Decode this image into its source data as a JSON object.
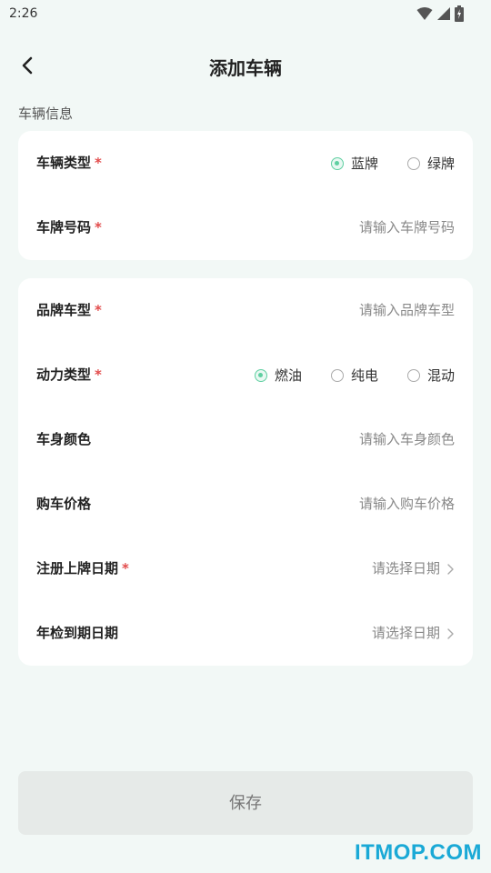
{
  "status_bar": {
    "time": "2:26"
  },
  "header": {
    "title": "添加车辆"
  },
  "section": {
    "label": "车辆信息"
  },
  "form": {
    "vehicle_type": {
      "label": "车辆类型",
      "required": "*",
      "options": [
        "蓝牌",
        "绿牌"
      ],
      "selected": "蓝牌"
    },
    "plate_number": {
      "label": "车牌号码",
      "required": "*",
      "placeholder": "请输入车牌号码"
    },
    "brand_model": {
      "label": "品牌车型",
      "required": "*",
      "placeholder": "请输入品牌车型"
    },
    "power_type": {
      "label": "动力类型",
      "required": "*",
      "options": [
        "燃油",
        "纯电",
        "混动"
      ],
      "selected": "燃油"
    },
    "body_color": {
      "label": "车身颜色",
      "placeholder": "请输入车身颜色"
    },
    "purchase_price": {
      "label": "购车价格",
      "placeholder": "请输入购车价格"
    },
    "registration_date": {
      "label": "注册上牌日期",
      "required": "*",
      "value": "请选择日期"
    },
    "inspection_date": {
      "label": "年检到期日期",
      "value": "请选择日期"
    }
  },
  "actions": {
    "save_label": "保存"
  },
  "watermark": "ITMOP.COM",
  "colors": {
    "accent": "#5fcfa1",
    "required": "#e24b4b",
    "background": "#f2f8f6",
    "button_disabled": "#e6eae8"
  },
  "icons": {
    "back": "chevron-left-icon",
    "picker": "chevron-right-icon",
    "wifi": "wifi-icon",
    "signal": "signal-icon",
    "battery": "battery-icon"
  }
}
